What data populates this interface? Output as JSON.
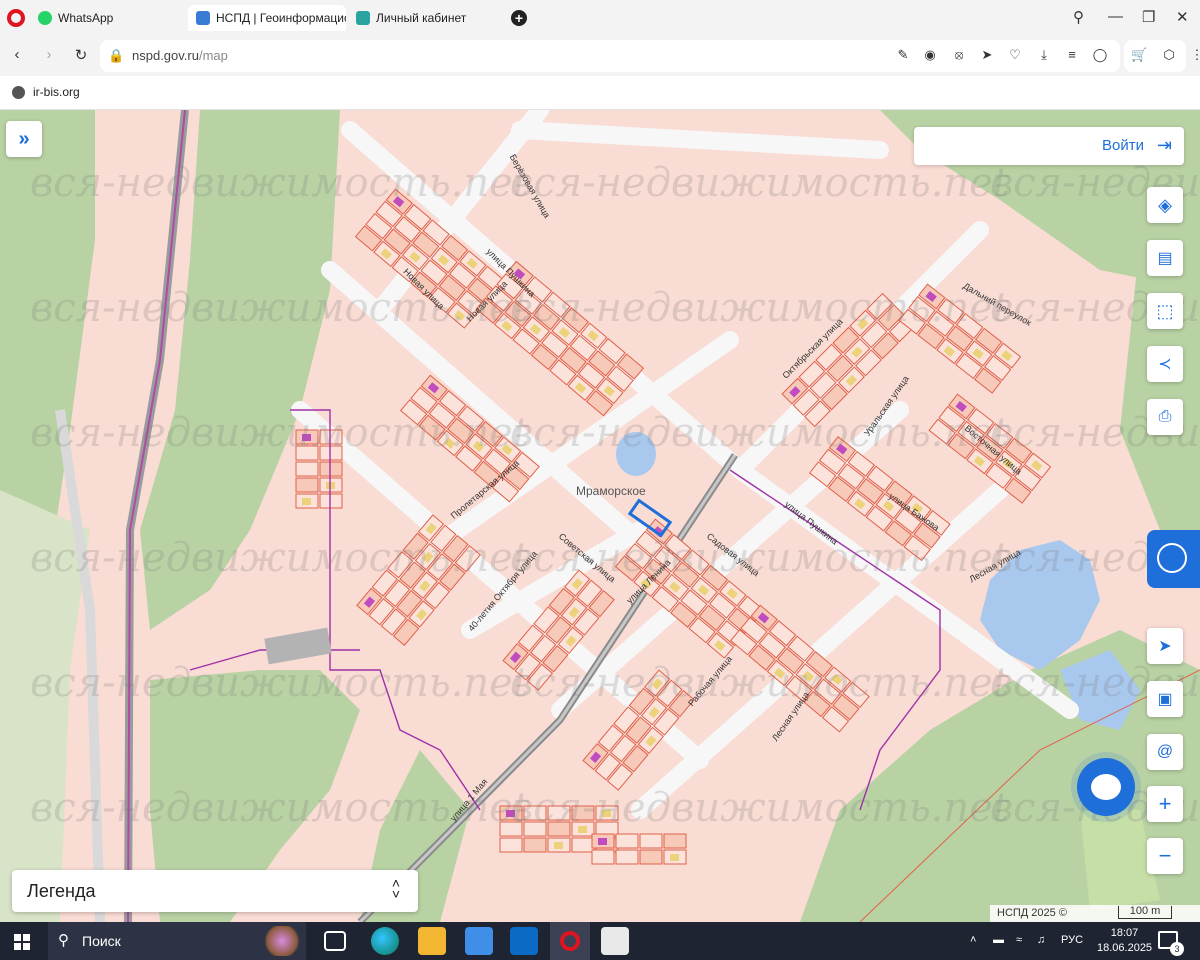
{
  "browser": {
    "tabs": [
      {
        "label": "WhatsApp"
      },
      {
        "label": "НСПД | Геоинформацион"
      },
      {
        "label": "Личный кабинет"
      }
    ],
    "address": {
      "host": "nspd.gov.ru",
      "path": "/map"
    },
    "bookmarks": [
      {
        "label": "ir-bis.org"
      }
    ]
  },
  "map": {
    "login_label": "Войти",
    "legend_label": "Легенда",
    "village_label": "Мраморское",
    "copyright": "НСПД 2025 ©",
    "scale_label": "100 m",
    "streets": [
      "Берёзовая улица",
      "улица Пушкина",
      "Новая улица",
      "Новая улица",
      "Октябрьская улица",
      "Дальний переулок",
      "Уральская улица",
      "Восточная улица",
      "Пролетарская улица",
      "улица Пушкина",
      "улица Бажова",
      "Советская улица",
      "Садовая улица",
      "Лесная улица",
      "40-летия Октября улица",
      "Рабочая улица",
      "Лесная улица",
      "улица Ленина",
      "улица 1 Мая"
    ],
    "watermark": "вся-недвижимость.net",
    "colors": {
      "land": "#f9dcd4",
      "forest": "#b9d2a4",
      "water": "#a9c8ee",
      "parcel_stroke": "#e0604a",
      "accent": "#1e6fd9"
    }
  },
  "taskbar": {
    "search_label": "Поиск",
    "lang": "РУС",
    "time": "18:07",
    "date": "18.06.2025",
    "notifications": "3"
  }
}
